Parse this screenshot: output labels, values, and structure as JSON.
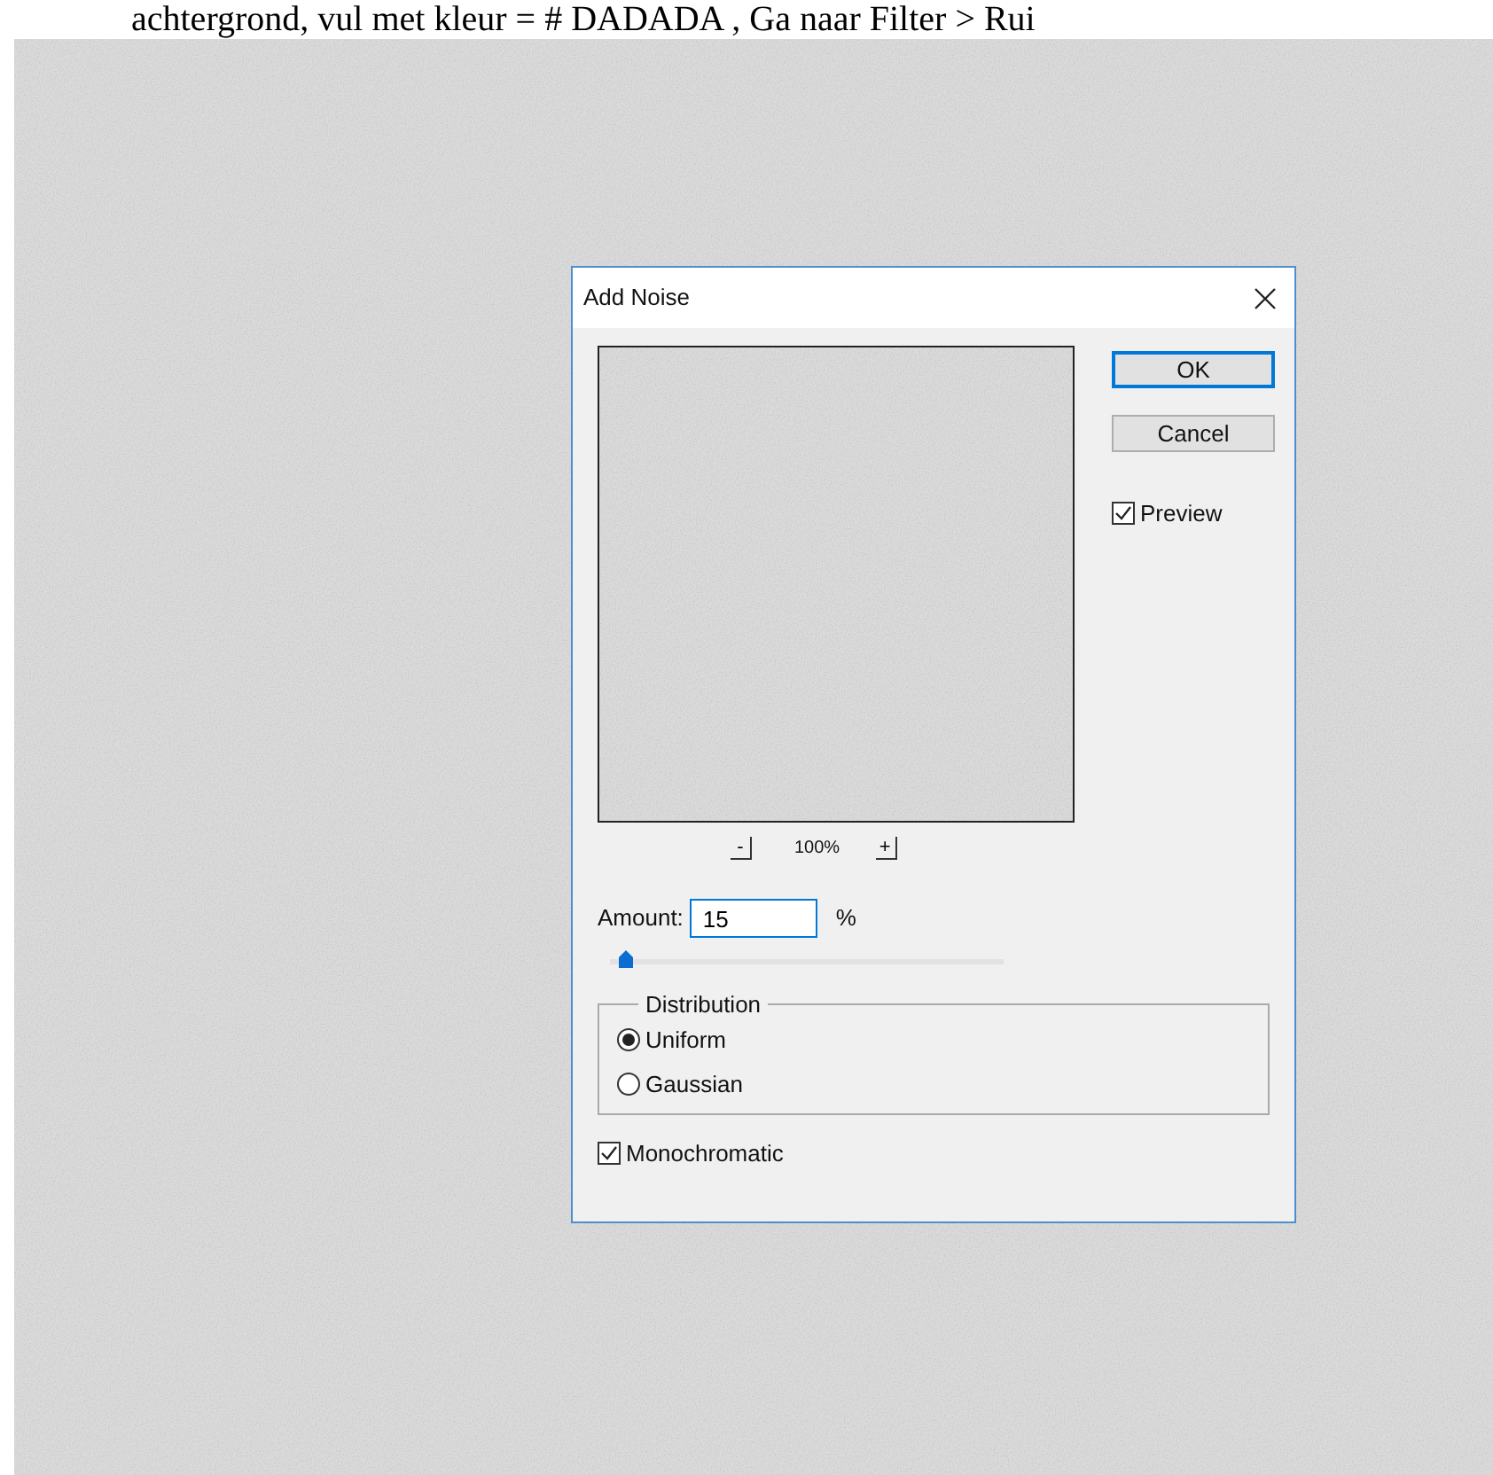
{
  "page_text": "achtergrond, vul met kleur = # DADADA , Ga naar Filter > Rui",
  "dialog": {
    "title": "Add Noise",
    "buttons": [
      {
        "label": "OK",
        "default": true
      },
      {
        "label": "Cancel",
        "default": false
      }
    ],
    "preview": {
      "label": "Preview",
      "checked": true
    },
    "zoom": {
      "minus": "-",
      "reading": "100%",
      "plus": "+"
    },
    "amount": {
      "label": "Amount:",
      "value": "15",
      "unit": "%",
      "level": 0.04
    },
    "distribution": {
      "title": "Distribution",
      "options": [
        {
          "label": "Uniform",
          "selected": true
        },
        {
          "label": "Gaussian",
          "selected": false
        }
      ]
    },
    "monochromatic": {
      "label": "Monochromatic",
      "checked": true
    }
  }
}
